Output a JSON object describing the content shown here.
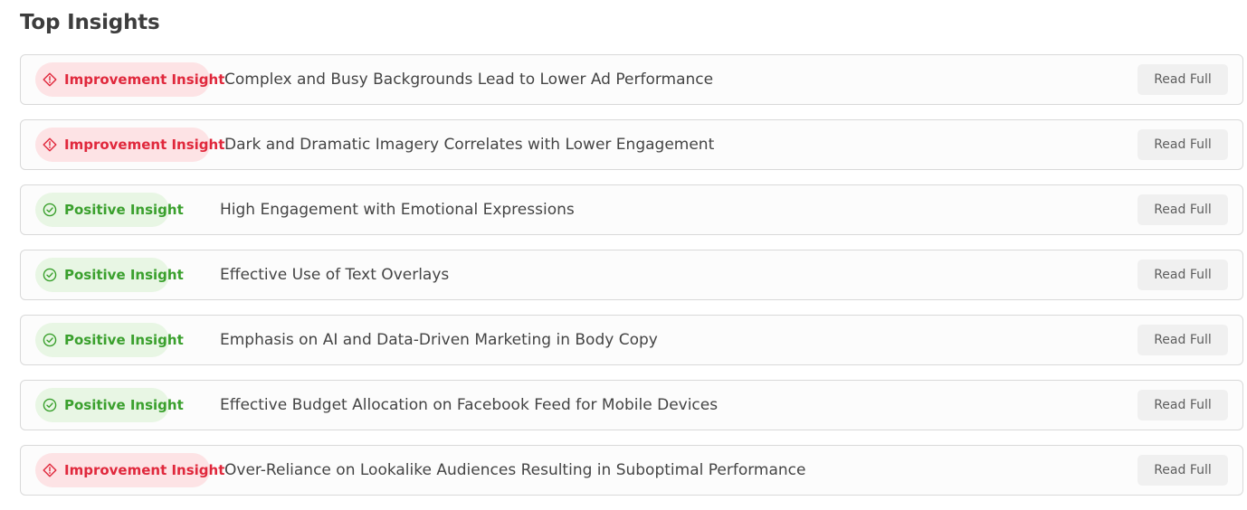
{
  "page": {
    "title": "Top Insights"
  },
  "colors": {
    "improvement_text": "#e0283c",
    "improvement_bg": "#fde3e5",
    "positive_text": "#3aa02d",
    "positive_bg": "#e8f6e4"
  },
  "insights": [
    {
      "type": "improvement",
      "badge_label": "Improvement Insight",
      "icon": "diamond-alert-icon",
      "title": "Complex and Busy Backgrounds Lead to Lower Ad Performance",
      "action_label": "Read Full"
    },
    {
      "type": "improvement",
      "badge_label": "Improvement Insight",
      "icon": "diamond-alert-icon",
      "title": "Dark and Dramatic Imagery Correlates with Lower Engagement",
      "action_label": "Read Full"
    },
    {
      "type": "positive",
      "badge_label": "Positive Insight",
      "icon": "check-circle-icon",
      "title": "High Engagement with Emotional Expressions",
      "action_label": "Read Full"
    },
    {
      "type": "positive",
      "badge_label": "Positive Insight",
      "icon": "check-circle-icon",
      "title": "Effective Use of Text Overlays",
      "action_label": "Read Full"
    },
    {
      "type": "positive",
      "badge_label": "Positive Insight",
      "icon": "check-circle-icon",
      "title": "Emphasis on AI and Data-Driven Marketing in Body Copy",
      "action_label": "Read Full"
    },
    {
      "type": "positive",
      "badge_label": "Positive Insight",
      "icon": "check-circle-icon",
      "title": "Effective Budget Allocation on Facebook Feed for Mobile Devices",
      "action_label": "Read Full"
    },
    {
      "type": "improvement",
      "badge_label": "Improvement Insight",
      "icon": "diamond-alert-icon",
      "title": "Over-Reliance on Lookalike Audiences Resulting in Suboptimal Performance",
      "action_label": "Read Full"
    }
  ]
}
